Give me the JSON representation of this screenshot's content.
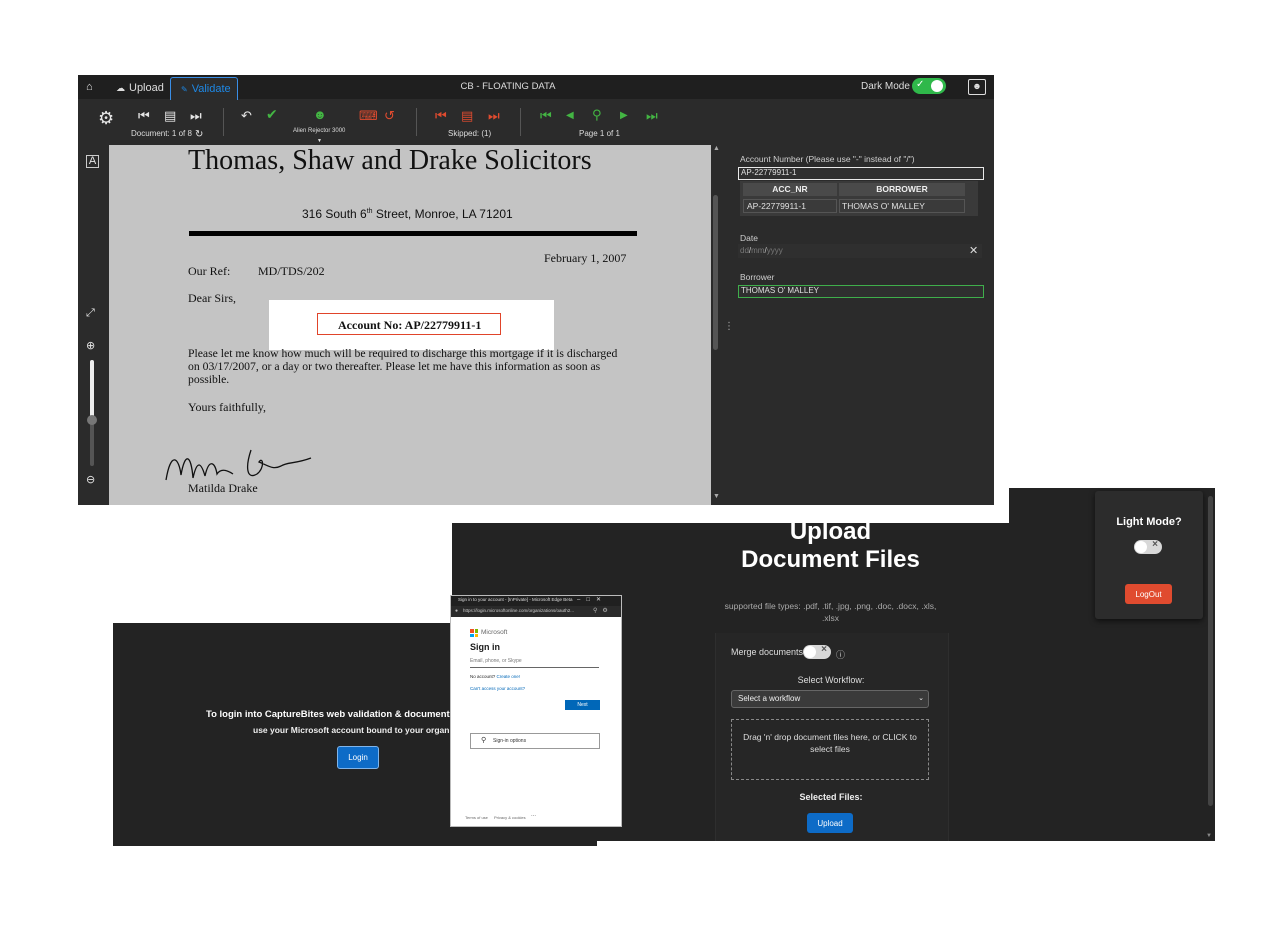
{
  "validate_app": {
    "tabs": {
      "home_icon": "home-icon",
      "upload": "Upload",
      "validate": "Validate"
    },
    "title": "CB - FLOATING DATA",
    "dark_mode_label": "Dark Mode",
    "toolbar": {
      "document_counter": "Document: 1 of 8",
      "rejector": "Alien Rejector 3000",
      "skipped": "Skipped: (1)",
      "page_counter": "Page 1 of 1"
    },
    "document": {
      "firm": "Thomas, Shaw and Drake Solicitors",
      "address_pre": "316 South 6",
      "address_sup": "th",
      "address_post": " Street, Monroe, LA 71201",
      "date": "February 1, 2007",
      "our_ref_label": "Our Ref:",
      "our_ref": "MD/TDS/202",
      "salutation": "Dear Sirs,",
      "account_line": "Account No:  AP/22779911-1",
      "body_line1": "Please let me know how much will be required to discharge this mortgage if it is discharged",
      "body_line2": "on 03/17/2007, or a day or two thereafter.  Please let me have this information as soon as",
      "body_line3": "possible.",
      "closing": "Yours faithfully,",
      "signer": "Matilda Drake"
    },
    "fields": {
      "account_label": "Account Number (Please use \"-\" instead of \"/\")",
      "account_value": "AP-22779911-1",
      "table_headers": [
        "ACC_NR",
        "BORROWER"
      ],
      "table_row": [
        "AP-22779911-1",
        "THOMAS O' MALLEY"
      ],
      "date_label": "Date",
      "date_placeholder_dd": "dd",
      "date_placeholder_mm": "mm",
      "date_placeholder_yyyy": "yyyy",
      "date_sep": "/",
      "borrower_label": "Borrower",
      "borrower_value": "THOMAS O' MALLEY"
    }
  },
  "login_app": {
    "line1": "To login into CaptureBites web validation & document",
    "line2": "use your Microsoft account bound to your organiz",
    "button": "Login"
  },
  "ms_popup": {
    "window_title": "Sign in to your account - [InPrivate] - Microsoft Edge Beta",
    "url": "https://login.microsoftonline.com/organizations/oauth2...",
    "brand": "Microsoft",
    "heading": "Sign in",
    "email_placeholder": "Email, phone, or Skype",
    "no_account": "No account?",
    "create_one": "Create one!",
    "cant_access": "Can't access your account?",
    "next": "Next",
    "sign_in_options": "Sign-in options",
    "terms": "Terms of use",
    "privacy": "Privacy & cookies",
    "more": "..."
  },
  "upload_app": {
    "title_line1": "Upload",
    "title_line2": "Document Files",
    "supported_line1": "supported file types: .pdf, .tif, .jpg, .png, .doc, .docx, .xls,",
    "supported_line2": ".xlsx",
    "merge_label": "Merge documents?",
    "select_workflow_label": "Select Workflow:",
    "workflow_selected": "Select a workflow",
    "dropzone_line1": "Drag 'n' drop document files here, or CLICK to",
    "dropzone_line2": "select files",
    "selected_files": "Selected Files:",
    "upload_button": "Upload",
    "light_mode": "Light Mode?",
    "logout": "LogOut"
  },
  "colors": {
    "accent_blue": "#0d6bc7",
    "toggle_green": "#2fb84a",
    "danger_red": "#e04b2f",
    "panel_dark": "#232323"
  }
}
